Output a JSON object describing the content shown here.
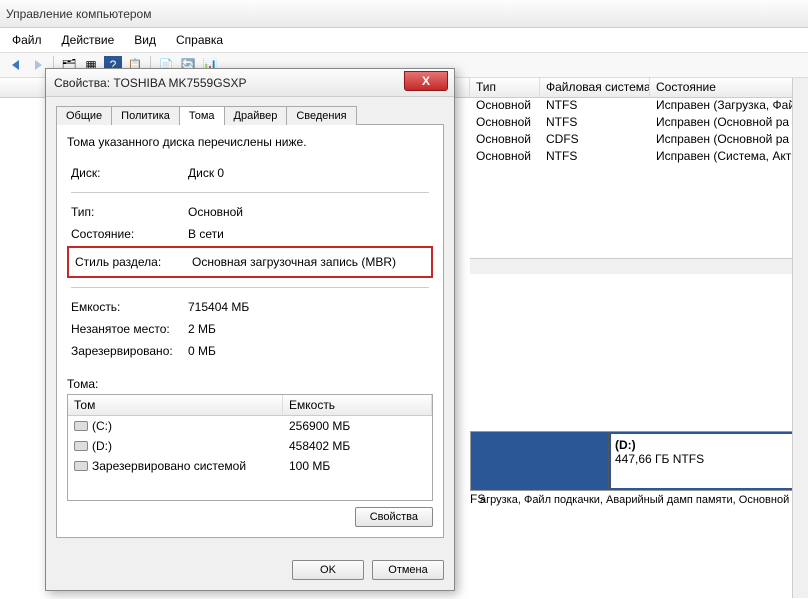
{
  "window": {
    "title": "Управление компьютером"
  },
  "menu": {
    "file": "Файл",
    "action": "Действие",
    "view": "Вид",
    "help": "Справка"
  },
  "bg_headers": {
    "type": "Тип",
    "fs": "Файловая система",
    "state": "Состояние"
  },
  "bg_rows": [
    {
      "type": "Основной",
      "fs": "NTFS",
      "state": "Исправен (Загрузка, Фай"
    },
    {
      "type": "Основной",
      "fs": "NTFS",
      "state": "Исправен (Основной ра"
    },
    {
      "type": "Основной",
      "fs": "CDFS",
      "state": "Исправен (Основной ра"
    },
    {
      "type": "Основной",
      "fs": "NTFS",
      "state": "Исправен (Система, Акт"
    }
  ],
  "bg_partition": {
    "title": "(D:)",
    "line2": "447,66 ГБ NTFS",
    "fs_tail": "FS",
    "below": "агрузка, Файл подкачки, Аварийный дамп памяти, Основной раз"
  },
  "dialog": {
    "title": "Свойства: TOSHIBA MK7559GSXP",
    "tabs": {
      "general": "Общие",
      "policy": "Политика",
      "volumes": "Тома",
      "driver": "Драйвер",
      "details": "Сведения"
    },
    "intro": "Тома указанного диска перечислены ниже.",
    "rows": {
      "disk_l": "Диск:",
      "disk_v": "Диск 0",
      "type_l": "Тип:",
      "type_v": "Основной",
      "state_l": "Состояние:",
      "state_v": "В сети",
      "style_l": "Стиль раздела:",
      "style_v": "Основная загрузочная запись (MBR)",
      "cap_l": "Емкость:",
      "cap_v": "715404 МБ",
      "free_l": "Незанятое место:",
      "free_v": "2 МБ",
      "res_l": "Зарезервировано:",
      "res_v": "0 МБ"
    },
    "vol_header": {
      "name": "Том",
      "cap": "Емкость"
    },
    "vol_label": "Тома:",
    "volumes": [
      {
        "name": "(C:)",
        "cap": "256900 МБ"
      },
      {
        "name": "(D:)",
        "cap": "458402 МБ"
      },
      {
        "name": "Зарезервировано системой",
        "cap": "100 МБ"
      }
    ],
    "props_btn": "Свойства",
    "ok": "OK",
    "cancel": "Отмена"
  }
}
